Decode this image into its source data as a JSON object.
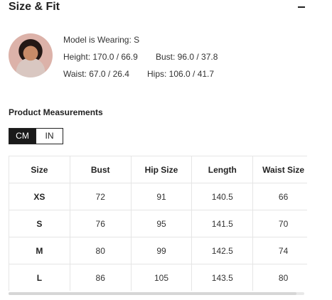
{
  "section": {
    "title": "Size & Fit"
  },
  "model": {
    "wearing": "Model is Wearing: S",
    "height": "Height: 170.0 / 66.9",
    "bust": "Bust: 96.0 / 37.8",
    "waist": "Waist: 67.0 / 26.4",
    "hips": "Hips: 106.0 / 41.7"
  },
  "product_measurements": {
    "title": "Product Measurements",
    "units": [
      "CM",
      "IN"
    ],
    "selected_unit": "CM"
  },
  "table": {
    "headers": [
      "Size",
      "Bust",
      "Hip Size",
      "Length",
      "Waist Size"
    ],
    "rows": [
      [
        "XS",
        "72",
        "91",
        "140.5",
        "66"
      ],
      [
        "S",
        "76",
        "95",
        "141.5",
        "70"
      ],
      [
        "M",
        "80",
        "99",
        "142.5",
        "74"
      ],
      [
        "L",
        "86",
        "105",
        "143.5",
        "80"
      ]
    ]
  },
  "colors": {
    "text": "#222222",
    "border": "#e5e5e5",
    "active_unit_bg": "#1a1a1a"
  }
}
